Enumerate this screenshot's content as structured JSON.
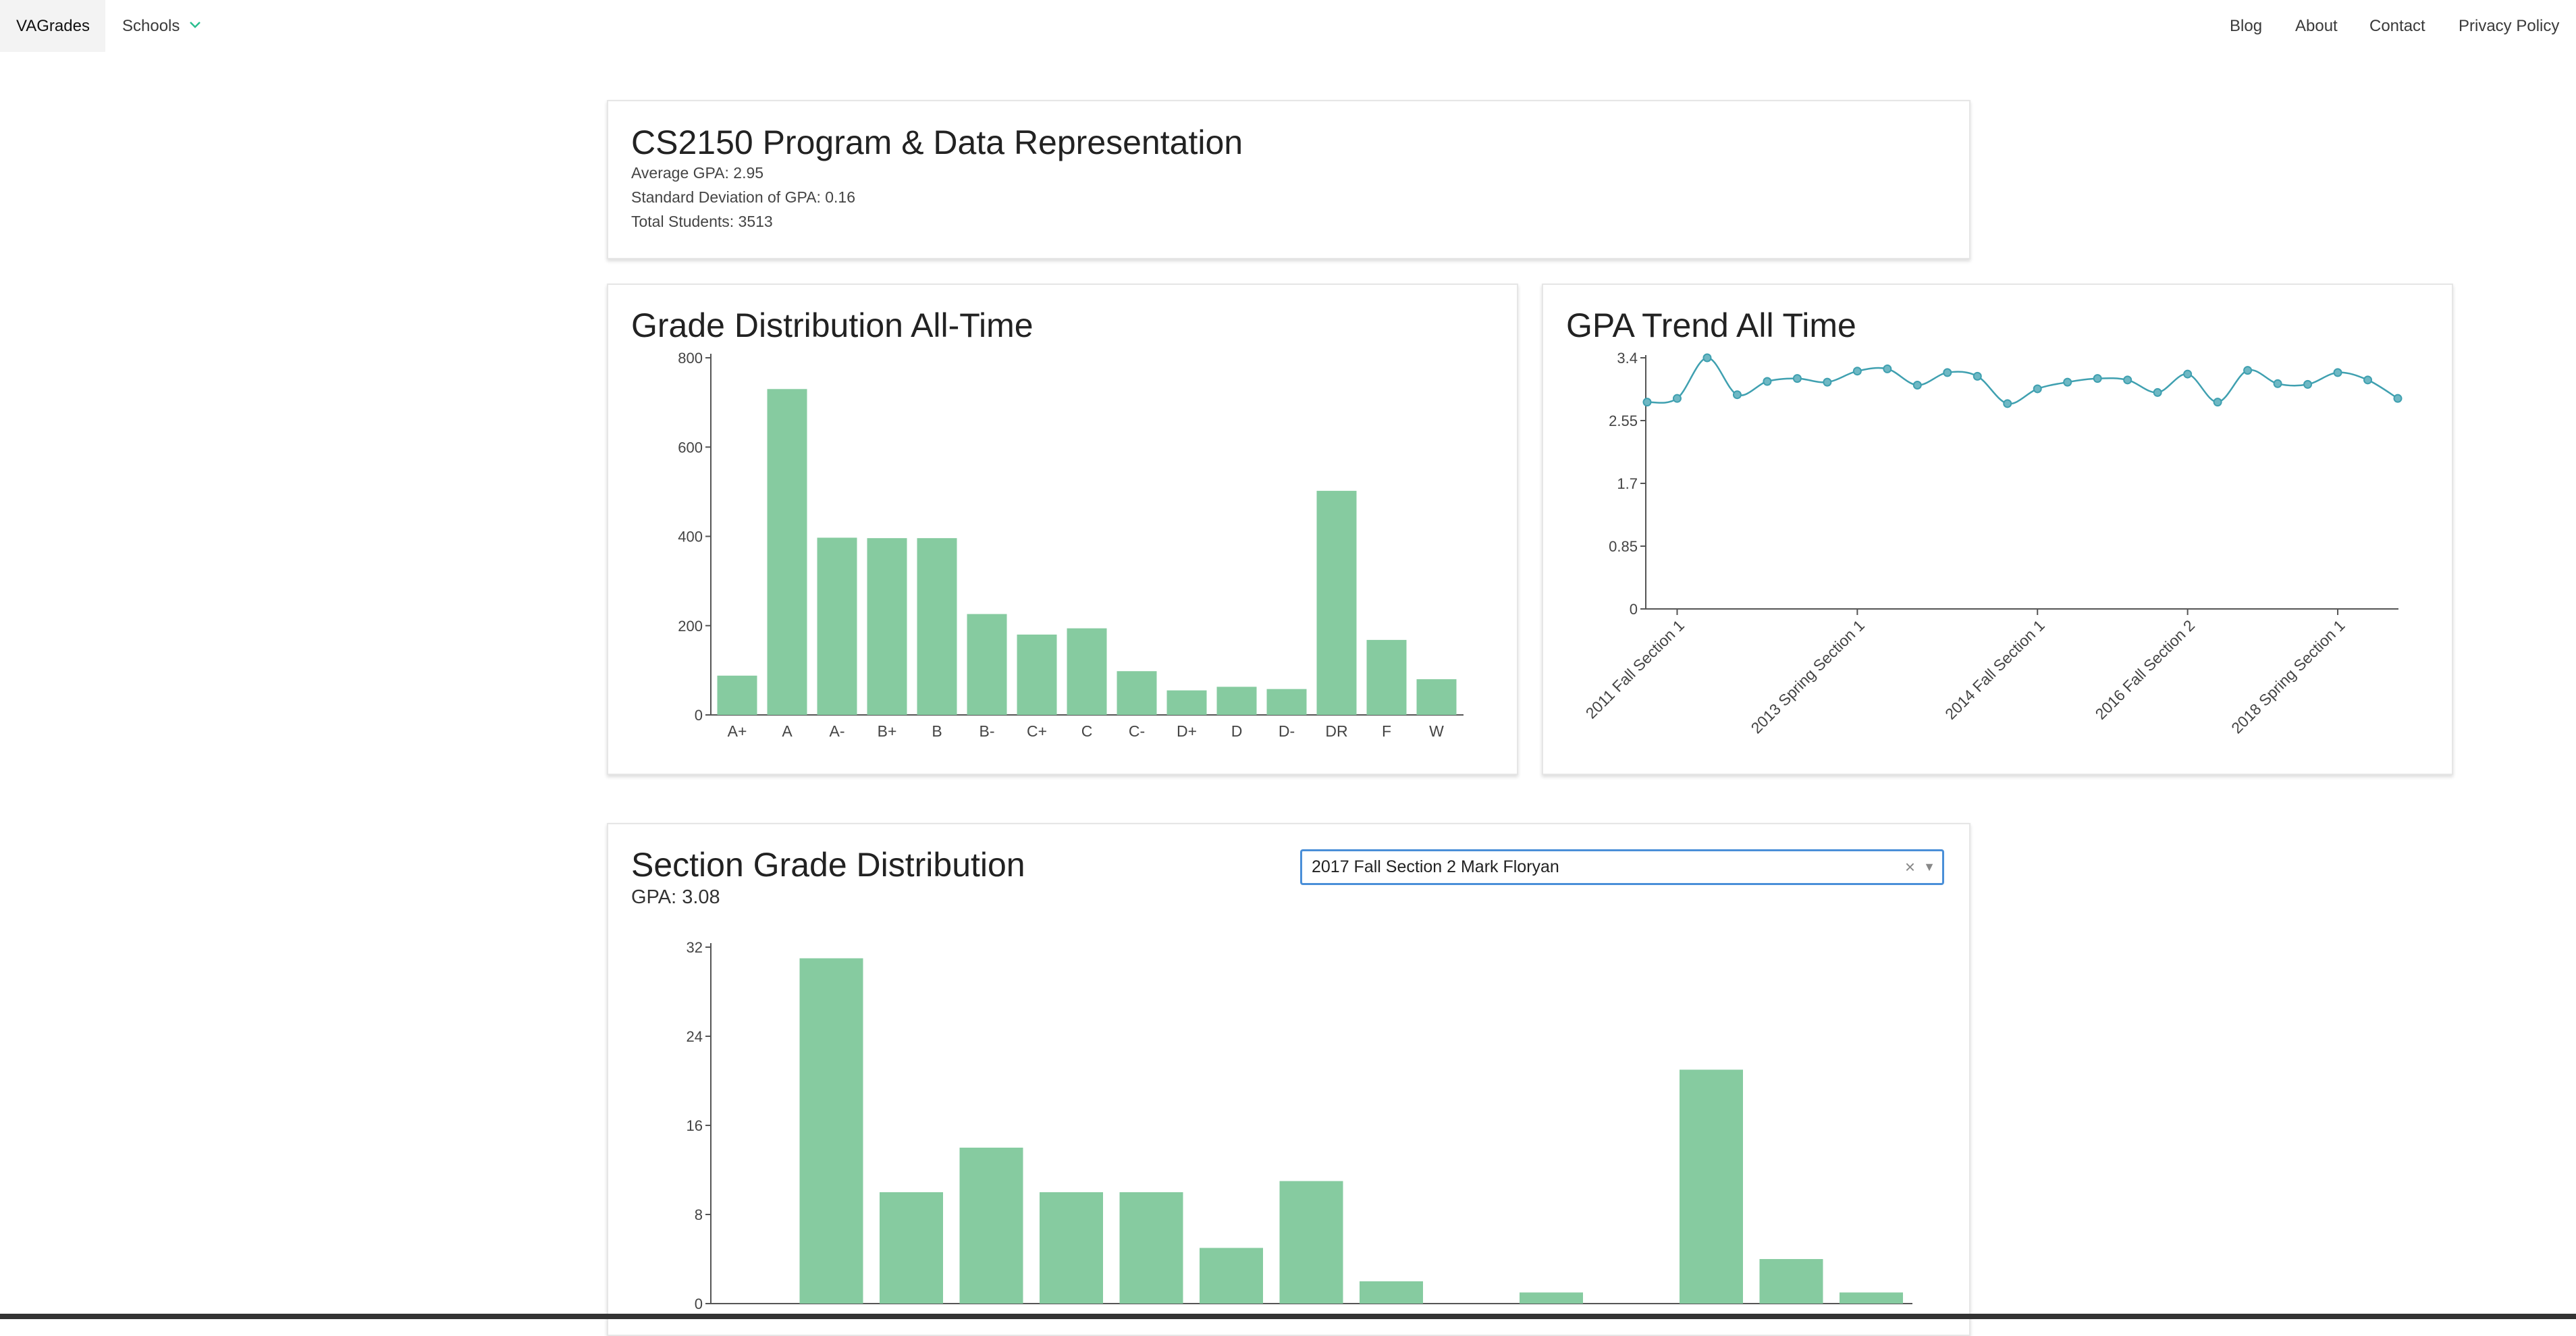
{
  "nav": {
    "brand": "VAGrades",
    "schools_label": "Schools",
    "links": [
      "Blog",
      "About",
      "Contact",
      "Privacy Policy"
    ]
  },
  "colors": {
    "bar": "#86cba0",
    "line": "#3fa0b0",
    "select_focus": "#4a8fd8",
    "chevron": "#2bbf8f"
  },
  "course": {
    "title": "CS2150 Program & Data Representation",
    "average_gpa": "Average GPA: 2.95",
    "std_dev": "Standard Deviation of GPA: 0.16",
    "total_students": "Total Students: 3513"
  },
  "grade_distribution": {
    "title": "Grade Distribution All-Time",
    "chart_data": {
      "type": "bar",
      "categories": [
        "A+",
        "A",
        "A-",
        "B+",
        "B",
        "B-",
        "C+",
        "C",
        "C-",
        "D+",
        "D",
        "D-",
        "DR",
        "F",
        "W"
      ],
      "values": [
        88,
        730,
        397,
        396,
        396,
        226,
        180,
        194,
        98,
        55,
        63,
        58,
        502,
        168,
        80
      ],
      "yticks": [
        0,
        200,
        400,
        600,
        800
      ],
      "ylim": [
        0,
        800
      ]
    }
  },
  "gpa_trend": {
    "title": "GPA Trend All Time",
    "chart_data": {
      "type": "line",
      "values": [
        2.8,
        2.85,
        3.4,
        2.9,
        3.08,
        3.12,
        3.07,
        3.22,
        3.25,
        3.03,
        3.2,
        3.15,
        2.78,
        2.98,
        3.07,
        3.12,
        3.1,
        2.93,
        3.18,
        2.8,
        3.23,
        3.05,
        3.04,
        3.2,
        3.1,
        2.85
      ],
      "tick_labels": [
        {
          "label": "2011 Fall Section 1",
          "index": 1
        },
        {
          "label": "2013 Spring Section 1",
          "index": 7
        },
        {
          "label": "2014 Fall Section 1",
          "index": 13
        },
        {
          "label": "2016 Fall Section 2",
          "index": 18
        },
        {
          "label": "2018 Spring Section 1",
          "index": 23
        }
      ],
      "yticks": [
        0,
        0.85,
        1.7,
        2.55,
        3.4
      ],
      "ylim": [
        0,
        3.4
      ]
    }
  },
  "section_distribution": {
    "title": "Section Grade Distribution",
    "gpa": "GPA: 3.08",
    "selected_section": "2017 Fall Section 2 Mark Floryan",
    "clear_symbol": "×",
    "chart_data": {
      "type": "bar",
      "values": [
        0,
        31,
        10,
        14,
        10,
        10,
        5,
        11,
        2,
        0,
        1,
        0,
        21,
        4,
        1
      ],
      "yticks": [
        0,
        8,
        16,
        24,
        32
      ],
      "ylim": [
        0,
        32
      ]
    }
  }
}
